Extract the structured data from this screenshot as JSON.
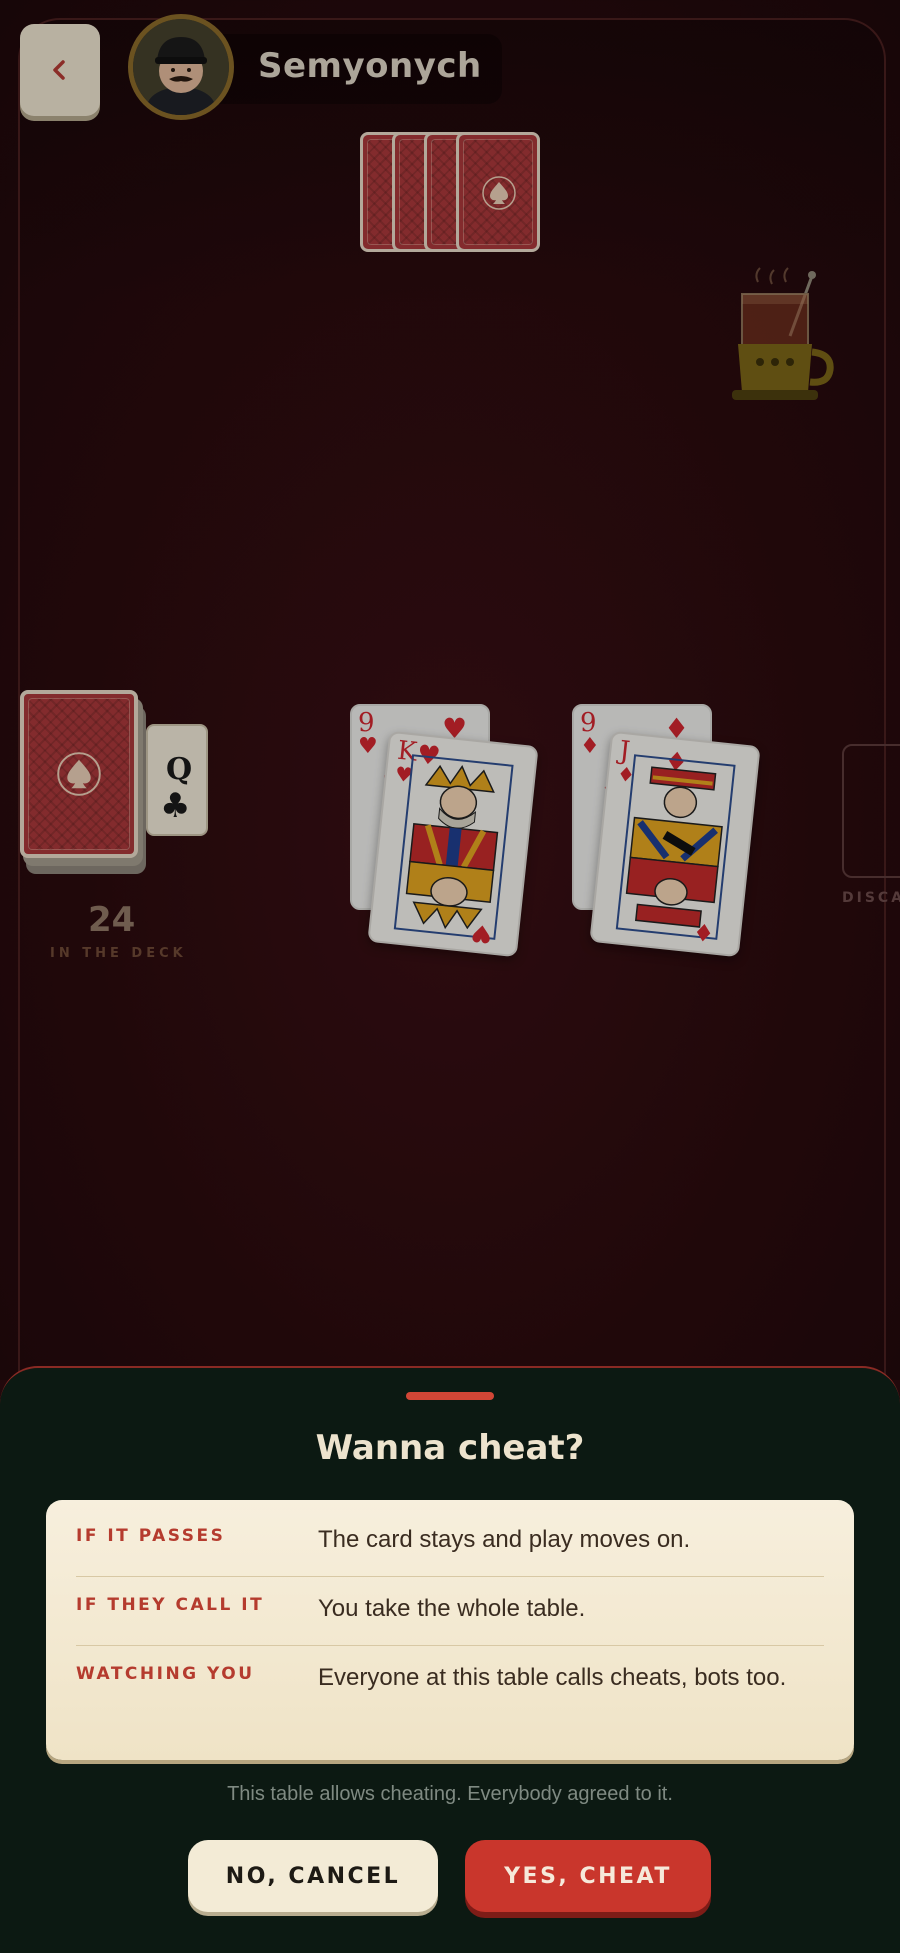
{
  "opponent": {
    "name": "Semyonych"
  },
  "deck": {
    "count": "24",
    "label": "IN THE DECK",
    "trump_rank": "Q",
    "trump_suit": "♣"
  },
  "discard": {
    "label": "DISCA"
  },
  "table_cards": [
    {
      "bottom_rank": "9",
      "bottom_suit": "♥",
      "top_rank": "K",
      "top_suit": "♥"
    },
    {
      "bottom_rank": "9",
      "bottom_suit": "♦",
      "top_rank": "J",
      "top_suit": "♦"
    }
  ],
  "dialog": {
    "title": "Wanna cheat?",
    "rows": [
      {
        "label": "IF IT PASSES",
        "text": "The card stays and play moves on."
      },
      {
        "label": "IF THEY CALL IT",
        "text": "You take the whole table."
      },
      {
        "label": "WATCHING YOU",
        "text": "Everyone at this table calls cheats, bots too."
      }
    ],
    "note": "This table allows cheating. Everybody agreed to it.",
    "cancel_label": "NO, CANCEL",
    "confirm_label": "YES, CHEAT"
  },
  "colors": {
    "accent": "#c9362c",
    "felt": "#2a0b0e",
    "sheet": "#0c1912",
    "cream": "#f3ebd6"
  },
  "icons": {
    "back": "chevron-left-icon",
    "tea": "tea-glass-icon",
    "spade": "spade-icon"
  }
}
